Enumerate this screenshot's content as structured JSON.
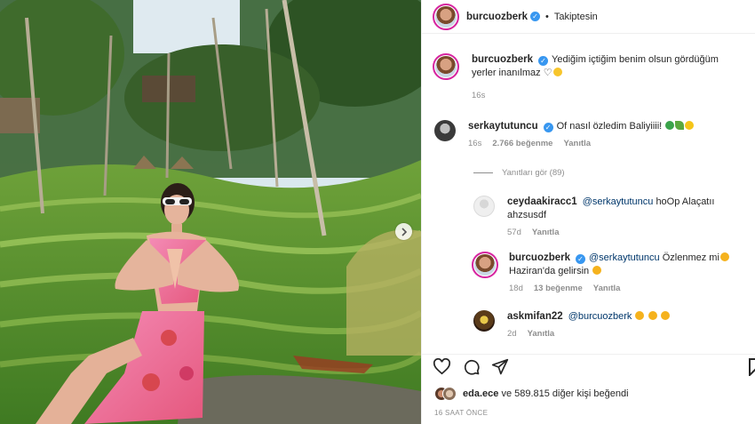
{
  "post": {
    "author": "burcuozberk",
    "follow_status": "Takiptesin",
    "caption": "Yediğim içtiğim benim olsun gördüğüm yerler inanılmaz",
    "caption_time": "16s"
  },
  "comments": [
    {
      "user": "serkaytutuncu",
      "verified": true,
      "text": "Of nasıl özledim Baliyiiii!",
      "time": "16s",
      "likes": "2.766 beğenme",
      "reply_label": "Yanıtla"
    }
  ],
  "replies_toggle": "Yanıtları gör (89)",
  "replies": [
    {
      "user": "ceydaakiracc1",
      "mention": "@serkaytutuncu",
      "text": "hoOp Alaçatıı ahzsusdf",
      "time": "57d",
      "reply_label": "Yanıtla"
    },
    {
      "user": "burcuozberk",
      "verified": true,
      "mention": "@serkaytutuncu",
      "text": "Özlenmez mi",
      "text2": "Haziran'da gelirsin",
      "time": "18d",
      "likes": "13 beğenme",
      "reply_label": "Yanıtla"
    },
    {
      "user": "askmifan22",
      "mention": "@burcuozberk",
      "text": "",
      "time": "2d",
      "reply_label": "Yanıtla"
    }
  ],
  "likes_line": {
    "user": "eda.ece",
    "rest": "ve 589.815 diğer kişi beğendi"
  },
  "timestamp": "16 SAAT ÖNCE",
  "icons": [
    "heart-icon",
    "comment-icon",
    "share-icon",
    "bookmark-icon",
    "verified-badge-icon",
    "next-arrow-icon",
    "smile-emoji-icon",
    "heart-outline-emoji-icon"
  ],
  "colors": {
    "verified": "#3897f0",
    "mention": "#00376b",
    "muted": "#8e8e8e",
    "story_ring": "#d6249f"
  }
}
